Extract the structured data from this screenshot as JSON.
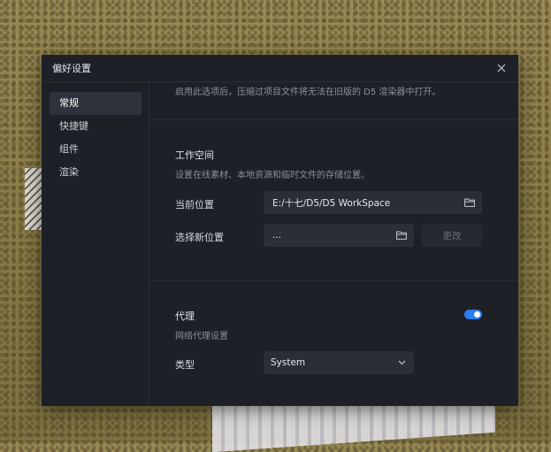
{
  "dialog": {
    "title": "偏好设置"
  },
  "sidebar": {
    "items": [
      {
        "label": "常规",
        "active": true
      },
      {
        "label": "快捷键"
      },
      {
        "label": "组件"
      },
      {
        "label": "渲染"
      }
    ]
  },
  "general": {
    "compression_note": "启用此选项后，压缩过项目文件将无法在旧版的 D5 渲染器中打开。",
    "workspace": {
      "title": "工作空间",
      "description": "设置在线素材、本地资源和临时文件的存储位置。",
      "current_label": "当前位置",
      "current_value": "E:/十七/D5/D5 WorkSpace",
      "new_label": "选择新位置",
      "new_value": "...",
      "change_button": "更改"
    },
    "proxy": {
      "title": "代理",
      "description": "网络代理设置",
      "enabled": true,
      "type_label": "类型",
      "type_value": "System"
    }
  },
  "colors": {
    "accent": "#2b7cf0",
    "dialog_bg": "#1e2028",
    "input_bg": "#2b2e38"
  }
}
